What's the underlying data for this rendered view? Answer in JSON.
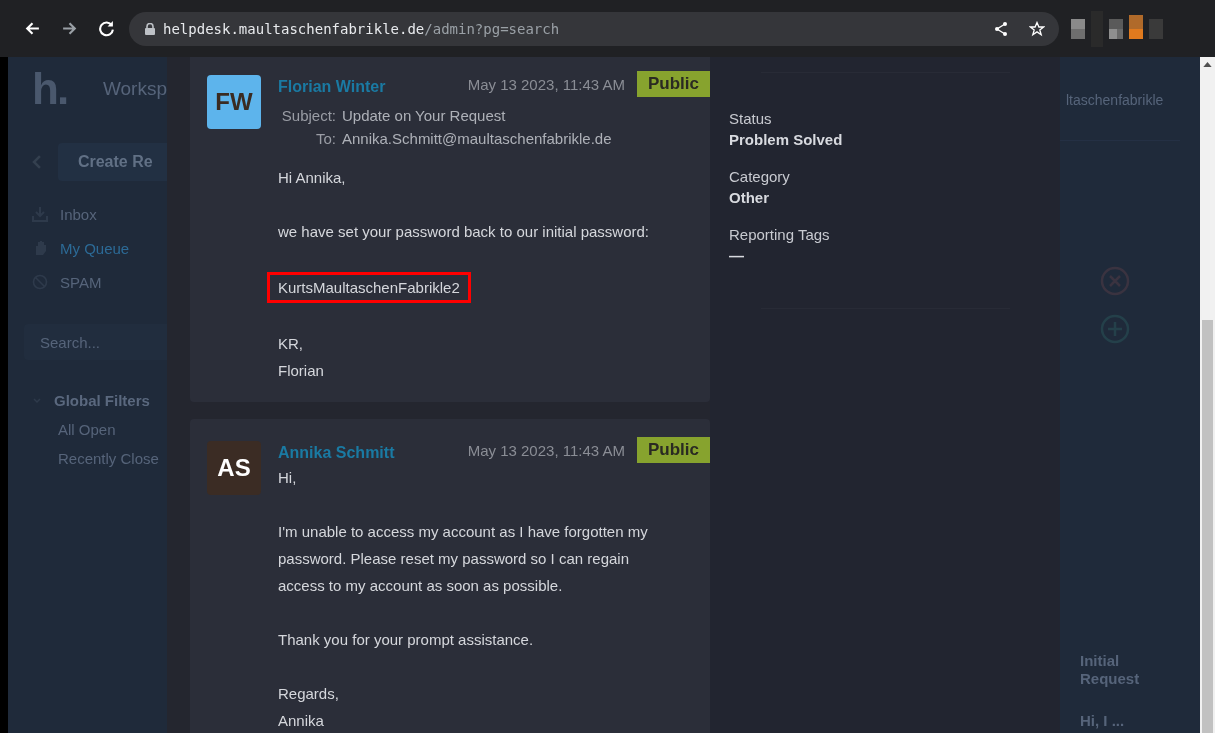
{
  "browser": {
    "url_host": "helpdesk.maultaschenfabrikle.de",
    "url_path": "/admin?pg=search"
  },
  "background": {
    "logo": "h.",
    "workspace": "Worksp",
    "create_button": "Create Re",
    "nav": [
      {
        "label": "Inbox",
        "kind": "inbox",
        "selected": false
      },
      {
        "label": "My Queue",
        "kind": "hand",
        "selected": true
      },
      {
        "label": "SPAM",
        "kind": "ban",
        "selected": false
      }
    ],
    "search": {
      "placeholder": "Search..."
    },
    "filters": {
      "title": "Global Filters",
      "expanded": true,
      "items": [
        "All Open",
        "Recently Close"
      ]
    },
    "right": {
      "header": "ltaschenfabrikle",
      "preview_title": "Initial Request",
      "preview_text": "Hi, I ..."
    }
  },
  "messages": [
    {
      "initials": "FW",
      "color": "#5db4ec",
      "author": "Florian Winter",
      "date": "May 13 2023, 11:43 AM",
      "visibility": "Public",
      "subject_label": "Subject:",
      "subject": "Update on Your Request",
      "to_label": "To:",
      "to": "Annika.Schmitt@maultaschenfabrikle.de",
      "paragraphs": [
        {
          "lines": [
            "Hi Annika,"
          ],
          "boxed": false
        },
        {
          "lines": [
            "we have set your password back to our initial password:"
          ],
          "boxed": false
        },
        {
          "lines": [
            "KurtsMaultaschenFabrikle2"
          ],
          "boxed": true
        },
        {
          "lines": [
            "KR,",
            "Florian"
          ],
          "boxed": false
        }
      ]
    },
    {
      "initials": "AS",
      "color": "#3b2c24",
      "author": "Annika Schmitt",
      "date": "May 13 2023, 11:43 AM",
      "visibility": "Public",
      "paragraphs": [
        {
          "lines": [
            "Hi,"
          ],
          "boxed": false
        },
        {
          "lines": [
            "I'm unable to access my account as I have forgotten my password. Please reset my password so I can regain access to my account as soon as possible."
          ],
          "boxed": false
        },
        {
          "lines": [
            "Thank you for your prompt assistance."
          ],
          "boxed": false
        },
        {
          "lines": [
            "Regards,",
            "Annika"
          ],
          "boxed": false
        }
      ]
    }
  ],
  "details": [
    {
      "label": "Status",
      "value": "Problem Solved"
    },
    {
      "label": "Category",
      "value": "Other"
    },
    {
      "label": "Reporting Tags",
      "value": "—"
    }
  ]
}
